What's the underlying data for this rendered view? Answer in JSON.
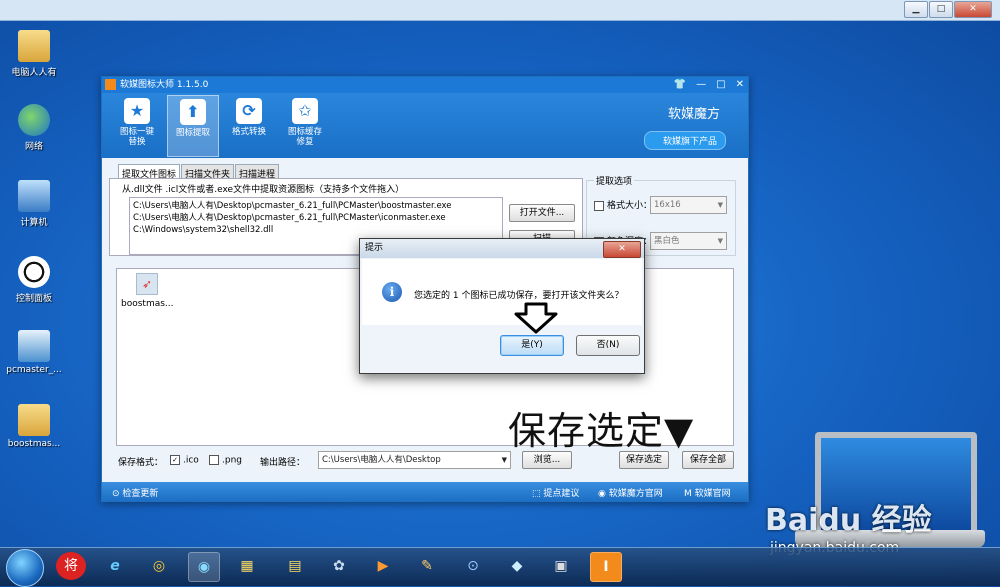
{
  "desktop": {
    "icons": [
      {
        "label": "电脑人人有",
        "icon": "folder-icon"
      },
      {
        "label": "网络",
        "icon": "network-icon"
      },
      {
        "label": "计算机",
        "icon": "computer-icon"
      },
      {
        "label": "控制面板",
        "icon": "control-panel-icon"
      },
      {
        "label": "pcmaster_...",
        "icon": "document-icon"
      },
      {
        "label": "boostmas...",
        "icon": "folder-icon"
      }
    ]
  },
  "outer_window": {
    "minimize": "▁",
    "maximize": "□",
    "close": "✕"
  },
  "app": {
    "title": "软媒图标大师 1.1.5.0",
    "controls": {
      "skin": "👕",
      "minimize": "—",
      "maximize": "□",
      "close": "✕"
    },
    "toolbar": [
      {
        "label_l1": "图标一键",
        "label_l2": "替换",
        "icon": "★"
      },
      {
        "label_l1": "图标提取",
        "label_l2": "",
        "icon": "⬆"
      },
      {
        "label_l1": "格式转换",
        "label_l2": "",
        "icon": "⟳"
      },
      {
        "label_l1": "图标缓存",
        "label_l2": "修复",
        "icon": "✩"
      }
    ],
    "brand": "软媒魔方",
    "brand_sub": "软媒旗下产品",
    "tabs": [
      "提取文件图标",
      "扫描文件夹",
      "扫描进程"
    ],
    "hint": "从.dll文件 .icl文件或者.exe文件中提取资源图标（支持多个文件拖入）",
    "files": [
      "C:\\Users\\电脑人人有\\Desktop\\pcmaster_6.21_full\\PCMaster\\boostmaster.exe",
      "C:\\Users\\电脑人人有\\Desktop\\pcmaster_6.21_full\\PCMaster\\iconmaster.exe",
      "C:\\Windows\\system32\\shell32.dll"
    ],
    "open_file_button": "打开文件...",
    "scan_button": "扫描",
    "options_title": "提取选项",
    "opt_size_label": "格式大小：",
    "opt_size_value": "16x16",
    "opt_color_label": "颜色深度：",
    "opt_color_value": "黑白色",
    "extracted_icon_label": "boostmas...",
    "save_format_label": "保存格式：",
    "fmt_ico": ".ico",
    "fmt_png": ".png",
    "ico_checked": "✓",
    "output_path_label": "输出路径：",
    "output_path_value": "C:\\Users\\电脑人人有\\Desktop",
    "browse_button": "浏览...",
    "save_selected_button": "保存选定",
    "save_all_button": "保存全部",
    "status": {
      "check_update": "检查更新",
      "feedback": "提点建议",
      "site1": "软媒魔方官网",
      "site2": "软媒官网"
    }
  },
  "dialog": {
    "title": "提示",
    "close": "✕",
    "message": "您选定的 1 个图标已成功保存，要打开该文件夹么？",
    "yes": "是(Y)",
    "no": "否(N)"
  },
  "caption": "保存选定▼",
  "watermark": "Baidu 经验",
  "watermark_sub": "jingyan.baidu.com",
  "taskbar": {
    "items": [
      "将",
      "e",
      "◎",
      "◉",
      "▦",
      "▤",
      "✿",
      "▶",
      "✎",
      "⊙",
      "◆",
      "▣",
      "I"
    ]
  }
}
